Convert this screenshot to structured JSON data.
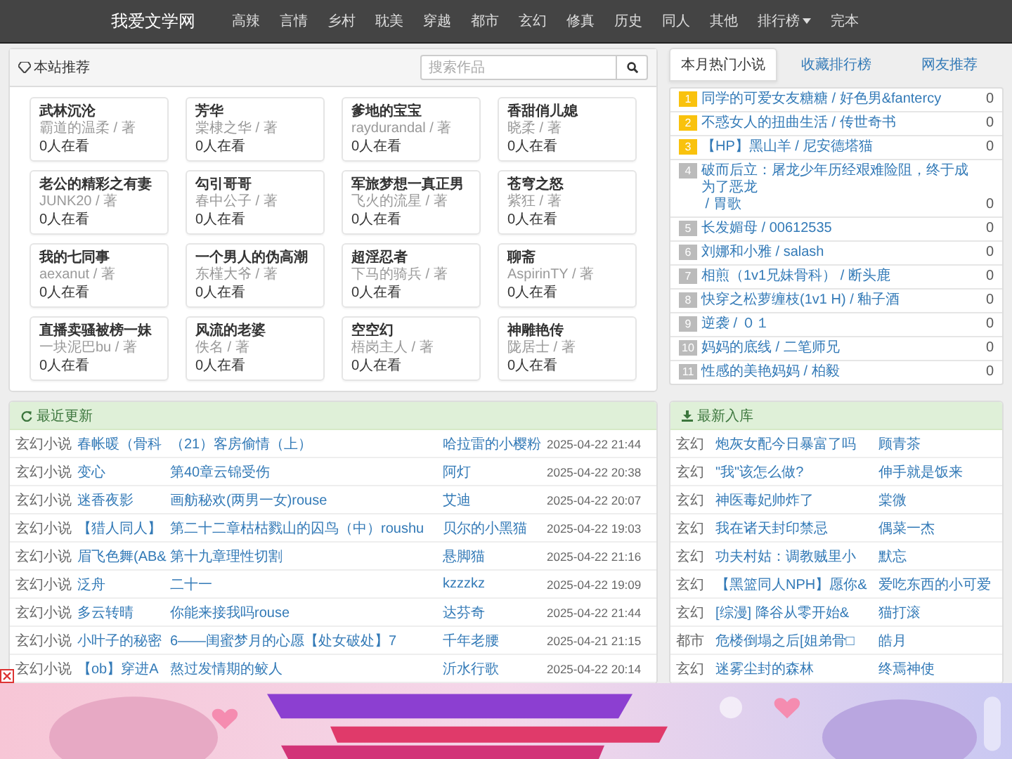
{
  "navbar": {
    "brand": "我爱文学网",
    "items": [
      {
        "label": "高辣",
        "has_menu": false
      },
      {
        "label": "言情",
        "has_menu": false
      },
      {
        "label": "乡村",
        "has_menu": false
      },
      {
        "label": "耽美",
        "has_menu": false
      },
      {
        "label": "穿越",
        "has_menu": false
      },
      {
        "label": "都市",
        "has_menu": false
      },
      {
        "label": "玄幻",
        "has_menu": false
      },
      {
        "label": "修真",
        "has_menu": false
      },
      {
        "label": "历史",
        "has_menu": false
      },
      {
        "label": "同人",
        "has_menu": false
      },
      {
        "label": "其他",
        "has_menu": false
      },
      {
        "label": "排行榜",
        "has_menu": true
      },
      {
        "label": "完本",
        "has_menu": false
      }
    ]
  },
  "recommend": {
    "title": "本站推荐",
    "search": {
      "placeholder": "搜索作品"
    },
    "books": [
      {
        "title": "武林沉沦",
        "author": "霸道的温柔 / 著",
        "readers": "0人在看"
      },
      {
        "title": "芳华",
        "author": "棠棣之华 / 著",
        "readers": "0人在看"
      },
      {
        "title": "爹地的宝宝",
        "author": "raydurandal / 著",
        "readers": "0人在看"
      },
      {
        "title": "香甜俏儿媳",
        "author": "晓柔 / 著",
        "readers": "0人在看"
      },
      {
        "title": "老公的精彩之有妻",
        "author": "JUNK20 / 著",
        "readers": "0人在看"
      },
      {
        "title": "勾引哥哥",
        "author": "春中公子 / 著",
        "readers": "0人在看"
      },
      {
        "title": "军旅梦想一真正男",
        "author": "飞火的流星 / 著",
        "readers": "0人在看"
      },
      {
        "title": "苍穹之怒",
        "author": "紫狂 / 著",
        "readers": "0人在看"
      },
      {
        "title": "我的七同事",
        "author": "aexanut / 著",
        "readers": "0人在看"
      },
      {
        "title": "一个男人的伪高潮",
        "author": "东槿大爷 / 著",
        "readers": "0人在看"
      },
      {
        "title": "超淫忍者",
        "author": "下马的骑兵 / 著",
        "readers": "0人在看"
      },
      {
        "title": "聊斋",
        "author": "AspirinTY / 著",
        "readers": "0人在看"
      },
      {
        "title": "直播卖骚被榜一妹",
        "author": "一块泥巴bu / 著",
        "readers": "0人在看"
      },
      {
        "title": "风流的老婆",
        "author": "佚名 / 著",
        "readers": "0人在看"
      },
      {
        "title": "空空幻",
        "author": "梧岗主人 / 著",
        "readers": "0人在看"
      },
      {
        "title": "神雕艳传",
        "author": "陇居士 / 著",
        "readers": "0人在看"
      }
    ]
  },
  "ranking": {
    "tabs": [
      {
        "label": "本月热门小说",
        "selected": true
      },
      {
        "label": "收藏排行榜",
        "selected": false
      },
      {
        "label": "网友推荐",
        "selected": false
      }
    ],
    "items": [
      {
        "rank": "1",
        "highlighted": true,
        "title": "同学的可爱女友糖糖",
        "author": "/ 好色男&fantercy",
        "count": "0"
      },
      {
        "rank": "2",
        "highlighted": true,
        "title": "不惑女人的扭曲生活",
        "author": "/ 传世奇书",
        "count": "0"
      },
      {
        "rank": "3",
        "highlighted": true,
        "title": "【HP】黑山羊",
        "author": "/ 尼安德塔猫",
        "count": "0"
      },
      {
        "rank": "4",
        "highlighted": false,
        "title": "破而后立：屠龙少年历经艰难险阻，终于成为了恶龙",
        "author": "/ 胃歌",
        "count": "0"
      },
      {
        "rank": "5",
        "highlighted": false,
        "title": "长发媚母",
        "author": "/ 00612535",
        "count": "0"
      },
      {
        "rank": "6",
        "highlighted": false,
        "title": "刘娜和小雅",
        "author": "/ salash",
        "count": "0"
      },
      {
        "rank": "7",
        "highlighted": false,
        "title": "相煎（1v1兄妹骨科）",
        "author": "/ 断头鹿",
        "count": "0"
      },
      {
        "rank": "8",
        "highlighted": false,
        "title": "快穿之松萝缠枝(1v1 H)",
        "author": "/ 釉子酒",
        "count": "0"
      },
      {
        "rank": "9",
        "highlighted": false,
        "title": "逆袭",
        "author": "/ ０１",
        "count": "0"
      },
      {
        "rank": "10",
        "highlighted": false,
        "title": "妈妈的底线",
        "author": "/ 二笔师兄",
        "count": "0"
      },
      {
        "rank": "11",
        "highlighted": false,
        "title": "性感的美艳妈妈",
        "author": "/ 柏毅",
        "count": "0"
      }
    ]
  },
  "recent_updates": {
    "title": "最近更新",
    "rows": [
      {
        "category": "玄幻小说",
        "book": "春帐暖（骨科",
        "chapter": "（21）客房偷情（上）",
        "author": "哈拉雷的小樱粉",
        "time": "2025-04-22 21:44"
      },
      {
        "category": "玄幻小说",
        "book": "变心",
        "chapter": "第40章云锦受伤",
        "author": "阿灯",
        "time": "2025-04-22 20:38"
      },
      {
        "category": "玄幻小说",
        "book": "迷香夜影",
        "chapter": "画舫秘欢(两男一女)rouse",
        "author": "艾迪",
        "time": "2025-04-22 20:07"
      },
      {
        "category": "玄幻小说",
        "book": "【猎人同人】",
        "chapter": "第二十二章枯枯戮山的囚鸟（中）roushu",
        "author": "贝尔的小黑猫",
        "time": "2025-04-22 19:03"
      },
      {
        "category": "玄幻小说",
        "book": "眉飞色舞(AB&",
        "chapter": "第十九章理性切割",
        "author": "悬脚猫",
        "time": "2025-04-22 21:16"
      },
      {
        "category": "玄幻小说",
        "book": "泛舟",
        "chapter": "二十一",
        "author": "kzzzkz",
        "time": "2025-04-22 19:09"
      },
      {
        "category": "玄幻小说",
        "book": "多云转晴",
        "chapter": "你能来接我吗rouse",
        "author": "达芬奇",
        "time": "2025-04-22 21:44"
      },
      {
        "category": "玄幻小说",
        "book": "小叶子的秘密",
        "chapter": "6——闺蜜梦月的心愿【处女破处】7",
        "author": "千年老腰",
        "time": "2025-04-21 21:15"
      },
      {
        "category": "玄幻小说",
        "book": "【ob】穿进A",
        "chapter": "熬过发情期的鲛人",
        "author": "沂水行歌",
        "time": "2025-04-22 20:14"
      }
    ]
  },
  "newest": {
    "title": "最新入库",
    "rows": [
      {
        "category": "玄幻",
        "book": "炮灰女配今日暴富了吗",
        "author": "顾青茶"
      },
      {
        "category": "玄幻",
        "book": "\"我\"该怎么做?",
        "author": "伸手就是饭来"
      },
      {
        "category": "玄幻",
        "book": "神医毒妃帅炸了",
        "author": "棠微"
      },
      {
        "category": "玄幻",
        "book": "我在诸天封印禁忌",
        "author": "偶菜一杰"
      },
      {
        "category": "玄幻",
        "book": "功夫村姑：调教贼里小",
        "author": "默忘"
      },
      {
        "category": "玄幻",
        "book": "【黑篮同人NPH】愿你&",
        "author": "爱吃东西的小可爱"
      },
      {
        "category": "玄幻",
        "book": "[综漫] 降谷从零开始&",
        "author": "猫打滚"
      },
      {
        "category": "都市",
        "book": "危楼倒塌之后[姐弟骨□",
        "author": "皓月"
      },
      {
        "category": "玄幻",
        "book": "迷雾尘封的森林",
        "author": "终焉神使"
      }
    ]
  }
}
